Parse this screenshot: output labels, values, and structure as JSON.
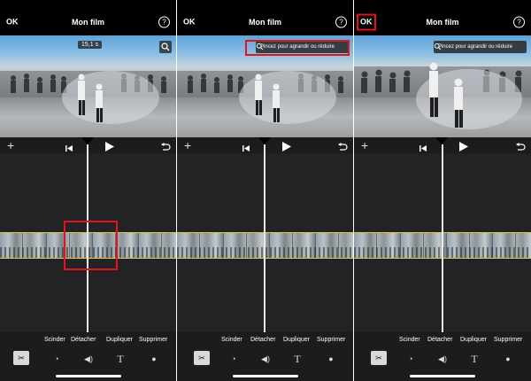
{
  "app": {
    "ok_label": "OK",
    "title": "Mon film",
    "help_glyph": "?"
  },
  "preview": {
    "time_badge": "15,1 s",
    "pinch_hint": "Pincez pour agrandir ou réduire"
  },
  "actions": [
    "Scinder",
    "Détacher",
    "Dupliquer",
    "Supprimer"
  ],
  "icons": {
    "add": "+",
    "help": "help-icon",
    "zoom": "magnifier-icon",
    "skip_back": "skip-back-icon",
    "play": "play-icon",
    "undo": "undo-icon",
    "scissors": "scissors-icon",
    "speed": "speedometer-icon",
    "volume": "volume-icon",
    "text": "T",
    "filters": "filters-icon"
  },
  "colors": {
    "highlight": "#e3151a",
    "clip_border": "#e5c842",
    "background": "#1c1c1e"
  }
}
